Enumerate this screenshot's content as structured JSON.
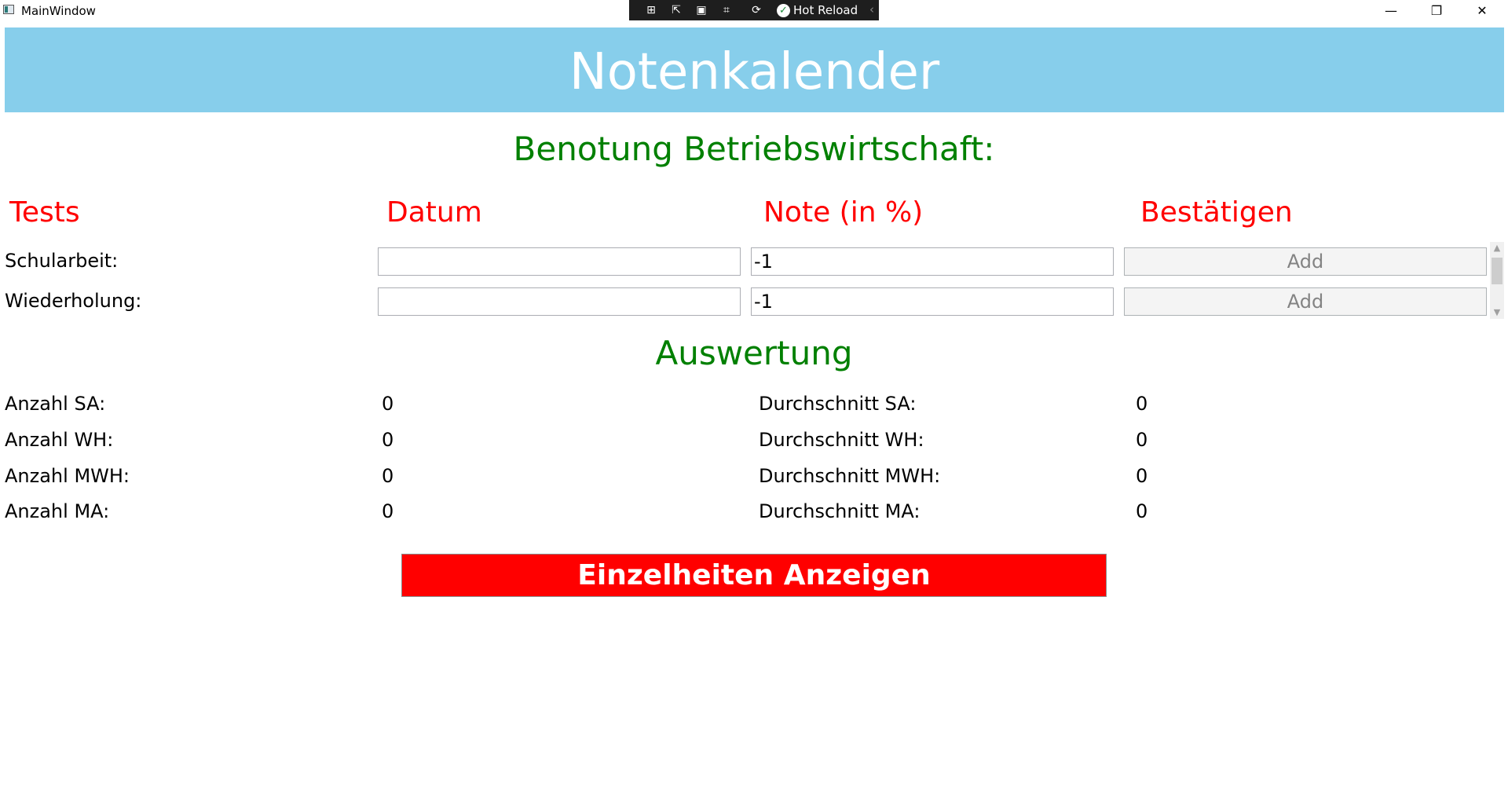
{
  "window": {
    "title": "MainWindow",
    "controls": {
      "minimize": "—",
      "restore": "❐",
      "close": "✕"
    }
  },
  "devtools": {
    "hot_reload_label": "Hot Reload",
    "collapse": "‹"
  },
  "header": {
    "title": "Notenkalender"
  },
  "grading": {
    "heading": "Benotung Betriebswirtschaft:",
    "columns": [
      "Tests",
      "Datum",
      "Note (in %)",
      "Bestätigen"
    ],
    "rows": [
      {
        "label": "Schularbeit:",
        "date": "",
        "grade": "-1",
        "button": "Add"
      },
      {
        "label": "Wiederholung:",
        "date": "",
        "grade": "-1",
        "button": "Add"
      }
    ]
  },
  "evaluation": {
    "heading": "Auswertung",
    "counts": [
      {
        "label": "Anzahl SA:",
        "value": "0"
      },
      {
        "label": "Anzahl WH:",
        "value": "0"
      },
      {
        "label": "Anzahl MWH:",
        "value": "0"
      },
      {
        "label": "Anzahl MA:",
        "value": "0"
      }
    ],
    "averages": [
      {
        "label": "Durchschnitt SA:",
        "value": "0"
      },
      {
        "label": "Durchschnitt WH:",
        "value": "0"
      },
      {
        "label": "Durchschnitt MWH:",
        "value": "0"
      },
      {
        "label": "Durchschnitt MA:",
        "value": "0"
      }
    ]
  },
  "details_button": "Einzelheiten Anzeigen",
  "colors": {
    "banner": "#87ceeb",
    "green_heading": "#008000",
    "red_heading": "#ff0000",
    "details_button": "#ff0000"
  }
}
